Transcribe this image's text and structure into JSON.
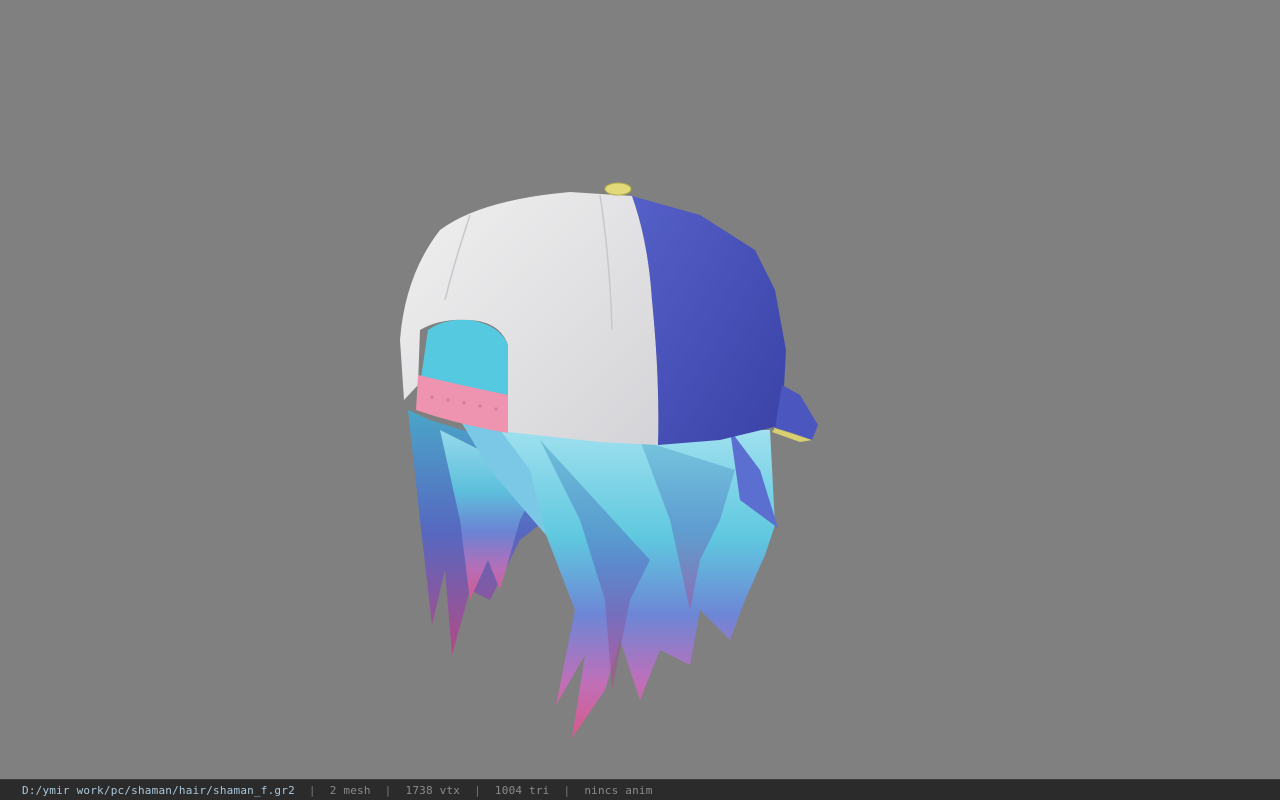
{
  "viewport": {
    "background": "#808080",
    "model": {
      "cap_colors": {
        "white": "#e6e6e6",
        "blue": "#4a52b8",
        "button": "#d8d070",
        "strap": "#e88aa6"
      },
      "hair_colors": {
        "top": "#8fd6e8",
        "mid": "#6a88d8",
        "tips": "#d8608f"
      }
    }
  },
  "status_bar": {
    "file_path": "D:/ymir work/pc/shaman/hair/shaman_f.gr2",
    "separator": "|",
    "mesh_count": "2 mesh",
    "vertex_count": "1738 vtx",
    "triangle_count": "1004 tri",
    "anim_status": "nincs anim"
  }
}
